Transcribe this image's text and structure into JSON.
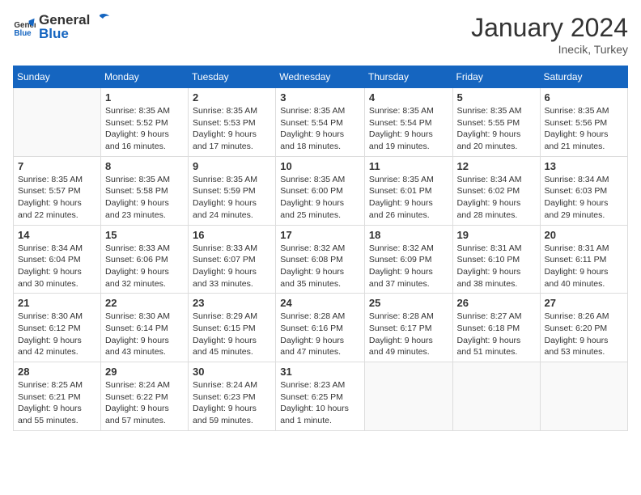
{
  "header": {
    "logo_general": "General",
    "logo_blue": "Blue",
    "month_year": "January 2024",
    "location": "Inecik, Turkey"
  },
  "weekdays": [
    "Sunday",
    "Monday",
    "Tuesday",
    "Wednesday",
    "Thursday",
    "Friday",
    "Saturday"
  ],
  "weeks": [
    [
      {
        "day": "",
        "empty": true
      },
      {
        "day": "1",
        "sunrise": "Sunrise: 8:35 AM",
        "sunset": "Sunset: 5:52 PM",
        "daylight": "Daylight: 9 hours and 16 minutes."
      },
      {
        "day": "2",
        "sunrise": "Sunrise: 8:35 AM",
        "sunset": "Sunset: 5:53 PM",
        "daylight": "Daylight: 9 hours and 17 minutes."
      },
      {
        "day": "3",
        "sunrise": "Sunrise: 8:35 AM",
        "sunset": "Sunset: 5:54 PM",
        "daylight": "Daylight: 9 hours and 18 minutes."
      },
      {
        "day": "4",
        "sunrise": "Sunrise: 8:35 AM",
        "sunset": "Sunset: 5:54 PM",
        "daylight": "Daylight: 9 hours and 19 minutes."
      },
      {
        "day": "5",
        "sunrise": "Sunrise: 8:35 AM",
        "sunset": "Sunset: 5:55 PM",
        "daylight": "Daylight: 9 hours and 20 minutes."
      },
      {
        "day": "6",
        "sunrise": "Sunrise: 8:35 AM",
        "sunset": "Sunset: 5:56 PM",
        "daylight": "Daylight: 9 hours and 21 minutes."
      }
    ],
    [
      {
        "day": "7",
        "sunrise": "Sunrise: 8:35 AM",
        "sunset": "Sunset: 5:57 PM",
        "daylight": "Daylight: 9 hours and 22 minutes."
      },
      {
        "day": "8",
        "sunrise": "Sunrise: 8:35 AM",
        "sunset": "Sunset: 5:58 PM",
        "daylight": "Daylight: 9 hours and 23 minutes."
      },
      {
        "day": "9",
        "sunrise": "Sunrise: 8:35 AM",
        "sunset": "Sunset: 5:59 PM",
        "daylight": "Daylight: 9 hours and 24 minutes."
      },
      {
        "day": "10",
        "sunrise": "Sunrise: 8:35 AM",
        "sunset": "Sunset: 6:00 PM",
        "daylight": "Daylight: 9 hours and 25 minutes."
      },
      {
        "day": "11",
        "sunrise": "Sunrise: 8:35 AM",
        "sunset": "Sunset: 6:01 PM",
        "daylight": "Daylight: 9 hours and 26 minutes."
      },
      {
        "day": "12",
        "sunrise": "Sunrise: 8:34 AM",
        "sunset": "Sunset: 6:02 PM",
        "daylight": "Daylight: 9 hours and 28 minutes."
      },
      {
        "day": "13",
        "sunrise": "Sunrise: 8:34 AM",
        "sunset": "Sunset: 6:03 PM",
        "daylight": "Daylight: 9 hours and 29 minutes."
      }
    ],
    [
      {
        "day": "14",
        "sunrise": "Sunrise: 8:34 AM",
        "sunset": "Sunset: 6:04 PM",
        "daylight": "Daylight: 9 hours and 30 minutes."
      },
      {
        "day": "15",
        "sunrise": "Sunrise: 8:33 AM",
        "sunset": "Sunset: 6:06 PM",
        "daylight": "Daylight: 9 hours and 32 minutes."
      },
      {
        "day": "16",
        "sunrise": "Sunrise: 8:33 AM",
        "sunset": "Sunset: 6:07 PM",
        "daylight": "Daylight: 9 hours and 33 minutes."
      },
      {
        "day": "17",
        "sunrise": "Sunrise: 8:32 AM",
        "sunset": "Sunset: 6:08 PM",
        "daylight": "Daylight: 9 hours and 35 minutes."
      },
      {
        "day": "18",
        "sunrise": "Sunrise: 8:32 AM",
        "sunset": "Sunset: 6:09 PM",
        "daylight": "Daylight: 9 hours and 37 minutes."
      },
      {
        "day": "19",
        "sunrise": "Sunrise: 8:31 AM",
        "sunset": "Sunset: 6:10 PM",
        "daylight": "Daylight: 9 hours and 38 minutes."
      },
      {
        "day": "20",
        "sunrise": "Sunrise: 8:31 AM",
        "sunset": "Sunset: 6:11 PM",
        "daylight": "Daylight: 9 hours and 40 minutes."
      }
    ],
    [
      {
        "day": "21",
        "sunrise": "Sunrise: 8:30 AM",
        "sunset": "Sunset: 6:12 PM",
        "daylight": "Daylight: 9 hours and 42 minutes."
      },
      {
        "day": "22",
        "sunrise": "Sunrise: 8:30 AM",
        "sunset": "Sunset: 6:14 PM",
        "daylight": "Daylight: 9 hours and 43 minutes."
      },
      {
        "day": "23",
        "sunrise": "Sunrise: 8:29 AM",
        "sunset": "Sunset: 6:15 PM",
        "daylight": "Daylight: 9 hours and 45 minutes."
      },
      {
        "day": "24",
        "sunrise": "Sunrise: 8:28 AM",
        "sunset": "Sunset: 6:16 PM",
        "daylight": "Daylight: 9 hours and 47 minutes."
      },
      {
        "day": "25",
        "sunrise": "Sunrise: 8:28 AM",
        "sunset": "Sunset: 6:17 PM",
        "daylight": "Daylight: 9 hours and 49 minutes."
      },
      {
        "day": "26",
        "sunrise": "Sunrise: 8:27 AM",
        "sunset": "Sunset: 6:18 PM",
        "daylight": "Daylight: 9 hours and 51 minutes."
      },
      {
        "day": "27",
        "sunrise": "Sunrise: 8:26 AM",
        "sunset": "Sunset: 6:20 PM",
        "daylight": "Daylight: 9 hours and 53 minutes."
      }
    ],
    [
      {
        "day": "28",
        "sunrise": "Sunrise: 8:25 AM",
        "sunset": "Sunset: 6:21 PM",
        "daylight": "Daylight: 9 hours and 55 minutes."
      },
      {
        "day": "29",
        "sunrise": "Sunrise: 8:24 AM",
        "sunset": "Sunset: 6:22 PM",
        "daylight": "Daylight: 9 hours and 57 minutes."
      },
      {
        "day": "30",
        "sunrise": "Sunrise: 8:24 AM",
        "sunset": "Sunset: 6:23 PM",
        "daylight": "Daylight: 9 hours and 59 minutes."
      },
      {
        "day": "31",
        "sunrise": "Sunrise: 8:23 AM",
        "sunset": "Sunset: 6:25 PM",
        "daylight": "Daylight: 10 hours and 1 minute."
      },
      {
        "day": "",
        "empty": true
      },
      {
        "day": "",
        "empty": true
      },
      {
        "day": "",
        "empty": true
      }
    ]
  ]
}
